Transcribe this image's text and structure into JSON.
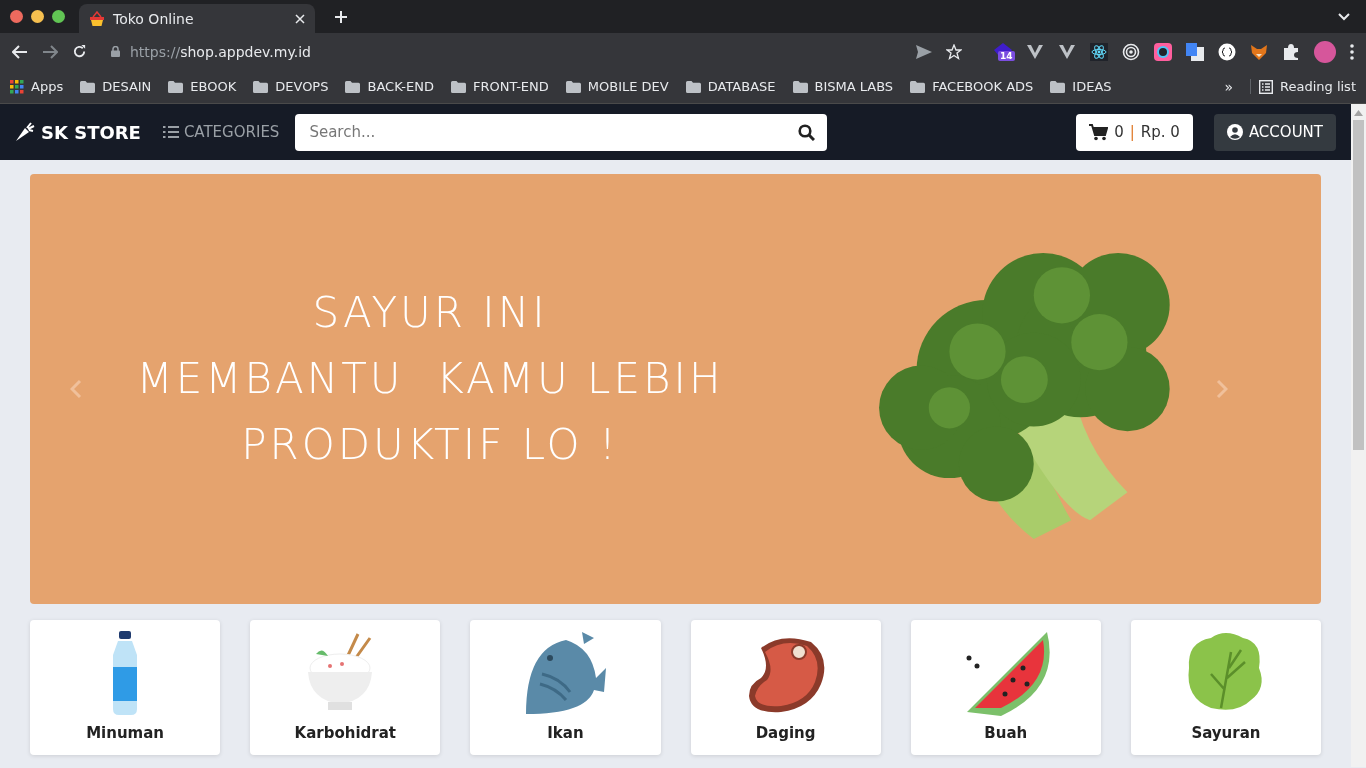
{
  "browser": {
    "tab": {
      "title": "Toko Online"
    },
    "address": {
      "scheme": "https://",
      "host": "shop.appdev.my.id"
    },
    "extension_badge": "14",
    "bookmarks": [
      {
        "label": "Apps",
        "kind": "apps"
      },
      {
        "label": "DESAIN",
        "kind": "folder"
      },
      {
        "label": "EBOOK",
        "kind": "folder"
      },
      {
        "label": "DEVOPS",
        "kind": "folder"
      },
      {
        "label": "BACK-END",
        "kind": "folder"
      },
      {
        "label": "FRONT-END",
        "kind": "folder"
      },
      {
        "label": "MOBILE DEV",
        "kind": "folder"
      },
      {
        "label": "DATABASE",
        "kind": "folder"
      },
      {
        "label": "BISMA LABS",
        "kind": "folder"
      },
      {
        "label": "FACEBOOK ADS",
        "kind": "folder"
      },
      {
        "label": "IDEAS",
        "kind": "folder"
      }
    ],
    "overflow": "»",
    "reading_list": "Reading list"
  },
  "navbar": {
    "brand": "SK STORE",
    "categories": "CATEGORIES",
    "search": {
      "placeholder": "Search..."
    },
    "cart": {
      "count": "0",
      "separator": "|",
      "total": "Rp. 0"
    },
    "account": "ACCOUNT"
  },
  "banner": {
    "lines": [
      "SAYUR INI",
      "MEMBANTU  KAMU LEBIH",
      "PRODUKTIF LO !"
    ]
  },
  "categories": [
    {
      "label": "Minuman",
      "kind": "bottle"
    },
    {
      "label": "Karbohidrat",
      "kind": "rice"
    },
    {
      "label": "Ikan",
      "kind": "fish"
    },
    {
      "label": "Daging",
      "kind": "meat"
    },
    {
      "label": "Buah",
      "kind": "watermelon"
    },
    {
      "label": "Sayuran",
      "kind": "lettuce"
    }
  ]
}
